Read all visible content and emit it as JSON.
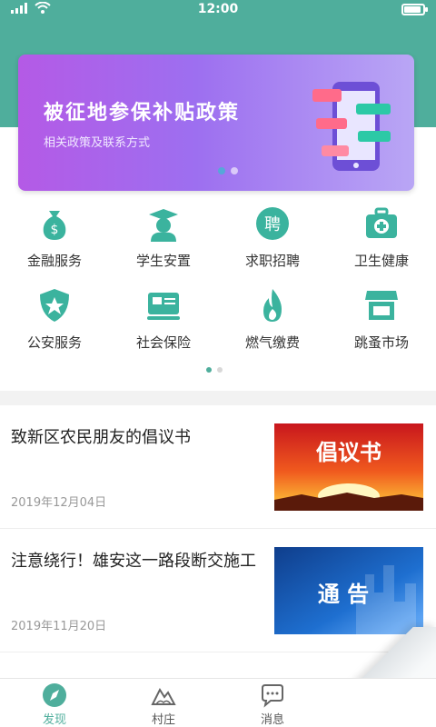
{
  "status_bar": {
    "time": "12:00"
  },
  "banner": {
    "title": "被征地参保补贴政策",
    "subtitle": "相关政策及联系方式",
    "colors": {
      "start": "#b45ae6",
      "end": "#b9a6f5"
    }
  },
  "services": [
    {
      "label": "金融服务",
      "icon": "money-bag-icon"
    },
    {
      "label": "学生安置",
      "icon": "graduate-icon"
    },
    {
      "label": "求职招聘",
      "icon": "hire-icon",
      "glyph": "聘"
    },
    {
      "label": "卫生健康",
      "icon": "medical-kit-icon"
    },
    {
      "label": "公安服务",
      "icon": "police-badge-icon"
    },
    {
      "label": "社会保险",
      "icon": "insurance-icon"
    },
    {
      "label": "燃气缴费",
      "icon": "flame-icon"
    },
    {
      "label": "跳蚤市场",
      "icon": "market-stall-icon"
    }
  ],
  "news": [
    {
      "title": "致新区农民朋友的倡议书",
      "date": "2019年12月04日",
      "thumb_text": "倡议书"
    },
    {
      "title": "注意绕行！雄安这一路段断交施工",
      "date": "2019年11月20日",
      "thumb_text": "通 告"
    }
  ],
  "tabs": [
    {
      "label": "发现",
      "icon": "compass-icon",
      "active": true
    },
    {
      "label": "村庄",
      "icon": "mountain-icon",
      "active": false
    },
    {
      "label": "消息",
      "icon": "chat-icon",
      "active": false
    }
  ],
  "theme": {
    "primary": "#4fae9c"
  }
}
